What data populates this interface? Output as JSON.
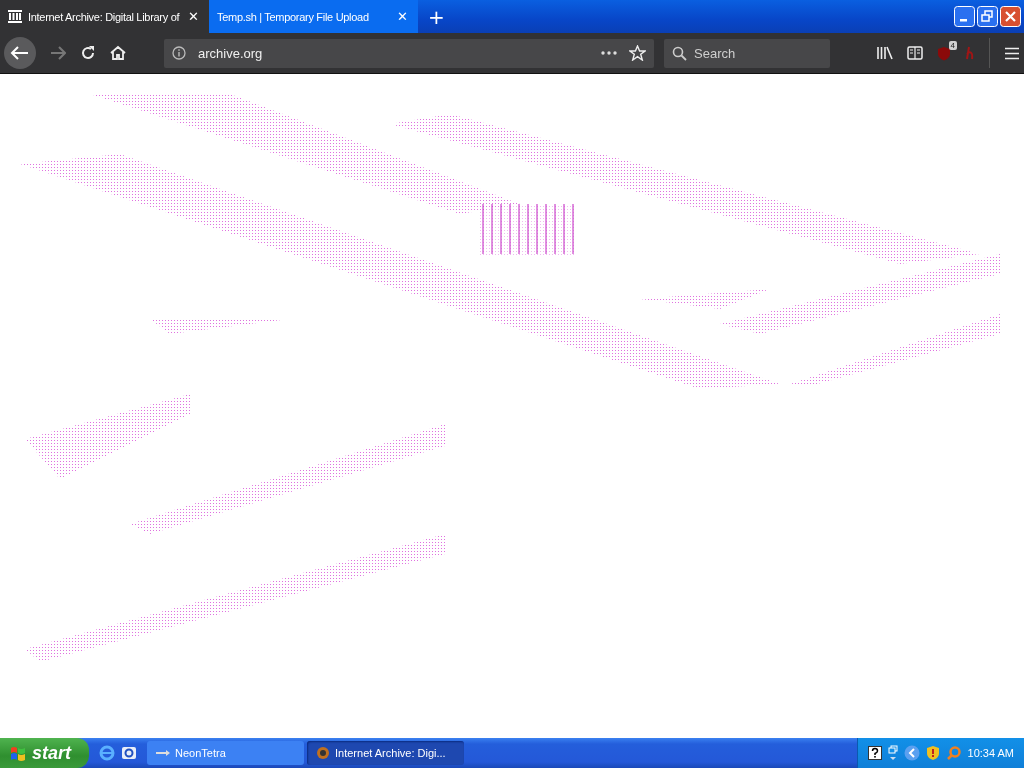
{
  "browser": {
    "tabs": [
      {
        "title": "Internet Archive: Digital Library of",
        "close": "✕",
        "selected": true
      },
      {
        "title": "Temp.sh | Temporary File Upload",
        "close": "✕",
        "selected": false
      }
    ],
    "new_tab": "+",
    "address": "archive.org",
    "search": {
      "placeholder": "Search"
    },
    "addon_badge": "4"
  },
  "taskbar": {
    "start": "start",
    "windows": [
      {
        "title": "NeonTetra",
        "selected": false
      },
      {
        "title": "Internet Archive: Digi...",
        "selected": true
      }
    ],
    "clock": "10:34 AM"
  }
}
